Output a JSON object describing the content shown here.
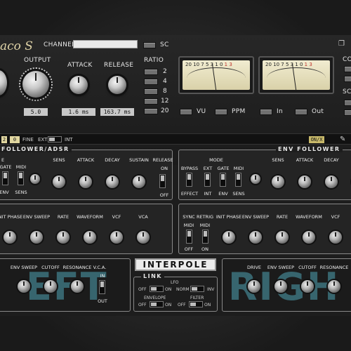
{
  "app": {
    "logo_text": "aco S"
  },
  "header": {
    "channel_label": "CHANNEL",
    "output_label": "OUTPUT",
    "attack_label": "ATTACK",
    "release_label": "RELEASE",
    "output_value": "5.0",
    "attack_value": "1.6 ms",
    "release_value": "163.7 ms",
    "sc_label": "SC",
    "ratio_label": "RATIO",
    "ratio_values": [
      "2",
      "4",
      "8",
      "12",
      "20"
    ],
    "vu_label": "VU",
    "ppm_label": "PPM",
    "in_label": "In",
    "out_label": "Out",
    "right_labels": [
      "CO",
      "SC"
    ]
  },
  "meters": {
    "scale_left": "20 10 7 5 3 1 0",
    "scale_red": "1 3",
    "scale_left_b": "20 10 7 5 3 1 0",
    "scale_red_b": "1 3"
  },
  "strip": {
    "box_value": "0",
    "fine_label": "FINE",
    "ext_label": "EXT",
    "int_label": "INT",
    "onoff_label": "ON/X"
  },
  "left_panel": {
    "title": "FOLLOWER/ADSR",
    "mode_label": "E",
    "gate_label": "GATE",
    "midi_label": "MIDI",
    "env_label": "ENV",
    "sens_label": "SENS",
    "knob_labels": [
      "SENS",
      "ATTACK",
      "DECAY",
      "SUSTAIN"
    ],
    "release_label": "RELEASE",
    "on_label": "ON",
    "off_label": "OFF"
  },
  "right_panel": {
    "title": "ENV FOLLOWER",
    "mode_label": "MODE",
    "bypass_label": "BYPASS",
    "ext_label": "EXT",
    "gate_label": "GATE",
    "midi_label": "MIDI",
    "effect_label": "EFFECT",
    "int_label": "INT",
    "env_label": "ENV",
    "sens_label": "SENS",
    "knob_labels": [
      "SENS",
      "ATTACK",
      "DECAY"
    ]
  },
  "left_lfo": {
    "labels": [
      "INIT PHASE",
      "ENV SWEEP",
      "RATE",
      "WAVEFORM",
      "VCF",
      "VCA"
    ]
  },
  "right_lfo": {
    "sync_label": "SYNC",
    "retrig_label": "RETRIG",
    "midi_label": "MIDI",
    "off_label": "OFF",
    "on_label": "ON",
    "labels": [
      "INIT PHASE",
      "ENV SWEEP",
      "RATE",
      "WAVEFORM",
      "VCF"
    ]
  },
  "left_filter": {
    "labels": [
      "ENV SWEEP",
      "CUTOFF",
      "RESONANCE",
      "V.C.A."
    ],
    "in_label": "IN",
    "out_label": "OUT",
    "big_text": "EFT"
  },
  "right_filter": {
    "labels": [
      "DRIVE",
      "ENV SWEEP",
      "CUTOFF",
      "RESONANCE"
    ],
    "big_text": "RIGH"
  },
  "center": {
    "brand": "INTERPOLE",
    "link_title": "LINK",
    "lfo_label": "LFO",
    "envelope_label": "ENVELOPE",
    "filter_label": "FILTER",
    "off_label": "OFF",
    "on_label": "ON",
    "norm_label": "NORM",
    "inv_label": "INV"
  }
}
